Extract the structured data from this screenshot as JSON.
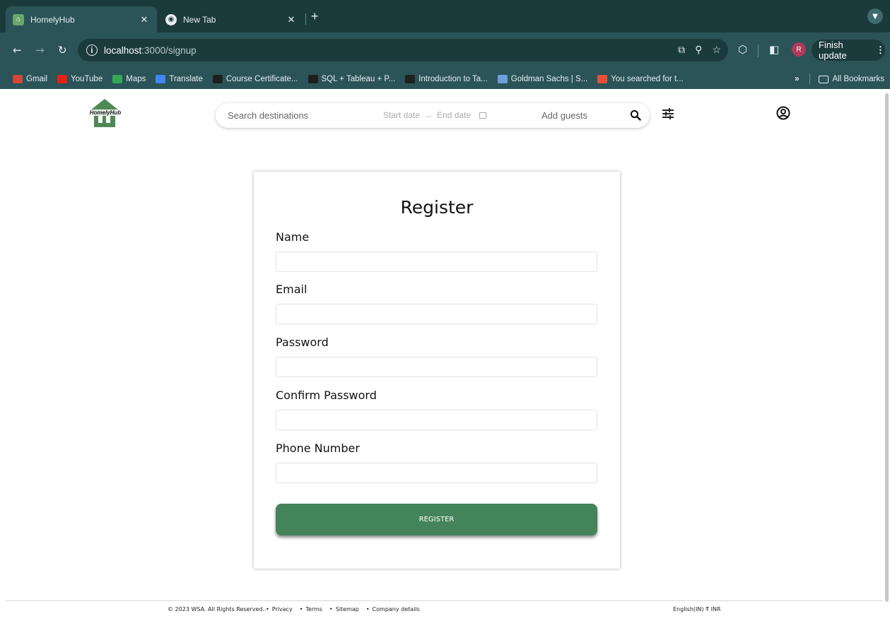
{
  "browser": {
    "tabs": [
      {
        "title": "HomelyHub",
        "active": true
      },
      {
        "title": "New Tab",
        "active": false
      }
    ],
    "url_host": "localhost",
    "url_path": ":3000/signup",
    "profile_initial": "R",
    "finish_update_label": "Finish update",
    "bookmarks": [
      {
        "label": "Gmail",
        "color": "#d44638"
      },
      {
        "label": "YouTube",
        "color": "#e62117"
      },
      {
        "label": "Maps",
        "color": "#34a853"
      },
      {
        "label": "Translate",
        "color": "#4285f4"
      },
      {
        "label": "Course Certificate...",
        "color": "#1f1f1f"
      },
      {
        "label": "SQL + Tableau + P...",
        "color": "#1f1f1f"
      },
      {
        "label": "Introduction to Ta...",
        "color": "#1f1f1f"
      },
      {
        "label": "Goldman Sachs | S...",
        "color": "#6f9fd8"
      },
      {
        "label": "You searched for t...",
        "color": "#e8503a"
      }
    ],
    "all_bookmarks_label": "All Bookmarks"
  },
  "header": {
    "logo_text": "HomelyHub",
    "search_placeholder": "Search destinations",
    "start_date": "Start date",
    "arrow": "→",
    "end_date": "End date",
    "guests_placeholder": "Add guests"
  },
  "form": {
    "title": "Register",
    "fields": [
      {
        "label": "Name",
        "value": ""
      },
      {
        "label": "Email",
        "value": ""
      },
      {
        "label": "Password",
        "value": ""
      },
      {
        "label": "Confirm Password",
        "value": ""
      },
      {
        "label": "Phone Number",
        "value": ""
      }
    ],
    "submit_label": "REGISTER"
  },
  "footer": {
    "copyright": "© 2023 WSA. All Rights Reserved..",
    "links": [
      "Privacy",
      "Terms",
      "Sitemap",
      "Company details"
    ],
    "locale": "English(IN) ₹ INR"
  },
  "colors": {
    "brand_green": "#43845a",
    "chrome_dark": "#1b3a3c",
    "chrome_mid": "#2a5457"
  }
}
